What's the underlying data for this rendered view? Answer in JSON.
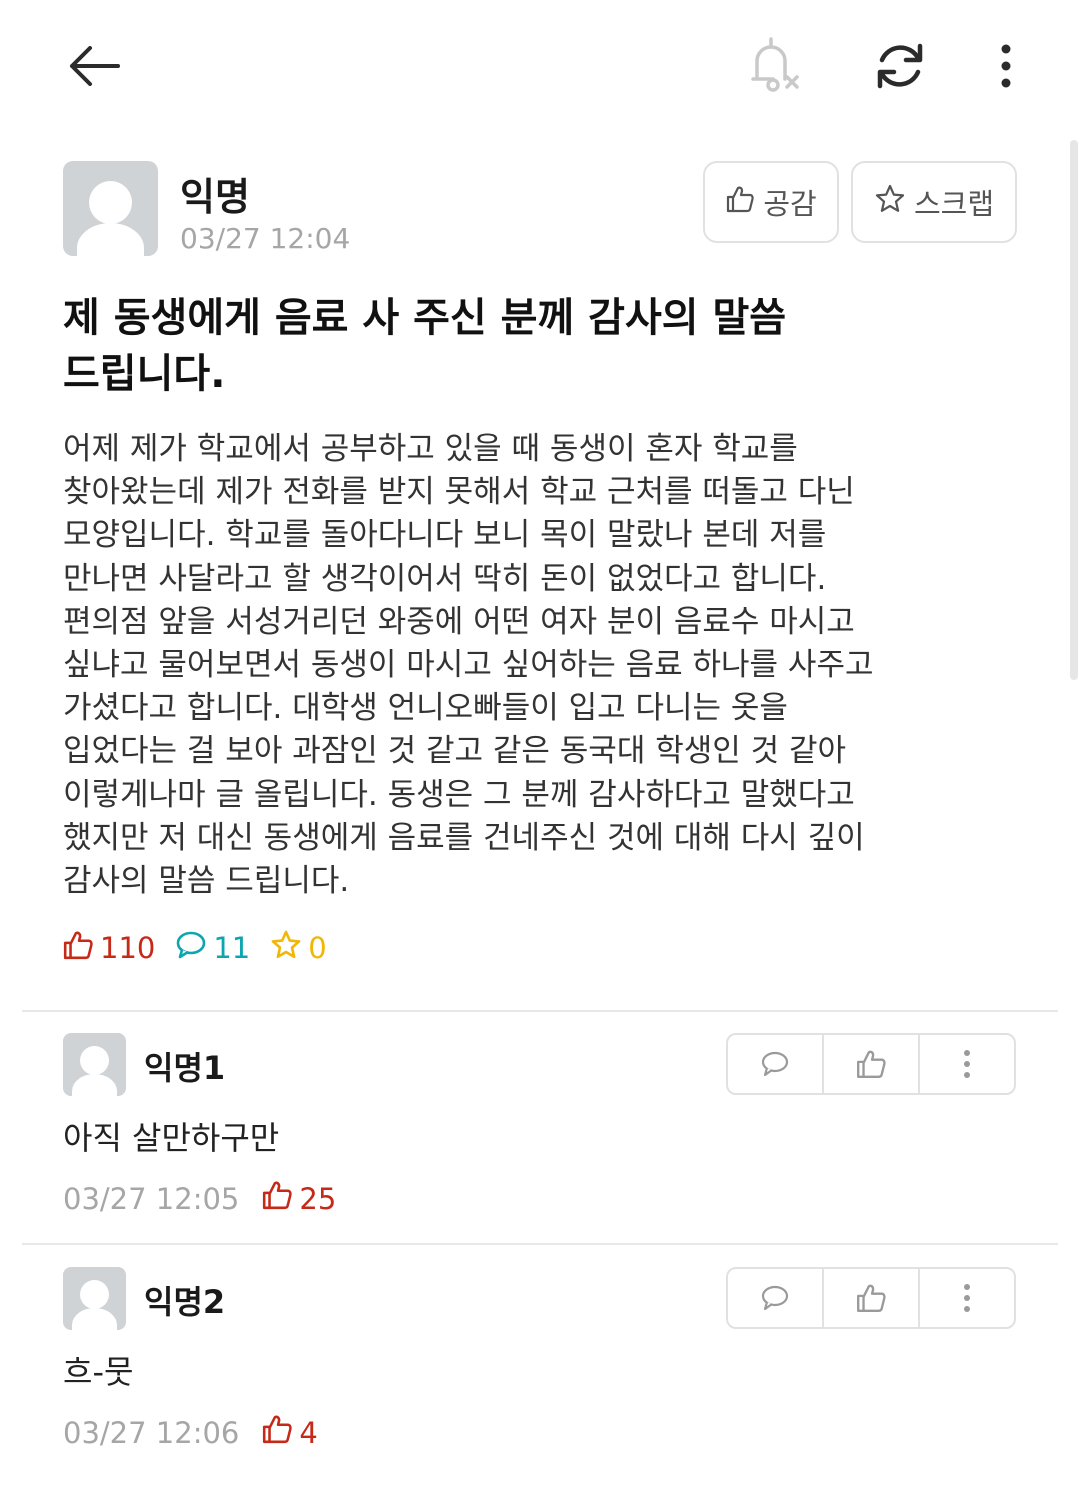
{
  "post": {
    "author": "익명",
    "time": "03/27 12:04",
    "like_button_label": "공감",
    "scrap_button_label": "스크랩",
    "title": "제 동생에게 음료 사 주신 분께 감사의 말씀\n드립니다.",
    "content": "어제 제가 학교에서 공부하고 있을 때 동생이 혼자 학교를\n찾아왔는데 제가 전화를 받지 못해서 학교 근처를 떠돌고 다닌\n모양입니다. 학교를 돌아다니다 보니 목이 말랐나 본데 저를\n만나면 사달라고 할 생각이어서 딱히 돈이 없었다고 합니다.\n편의점 앞을 서성거리던 와중에 어떤 여자 분이 음료수 마시고\n싶냐고 물어보면서 동생이 마시고 싶어하는 음료 하나를 사주고\n가셨다고 합니다. 대학생 언니오빠들이 입고 다니는 옷을\n입었다는 걸 보아 과잠인 것 같고 같은 동국대 학생인 것 같아\n이렇게나마 글 올립니다. 동생은 그 분께 감사하다고 말했다고\n했지만 저 대신 동생에게 음료를 건네주신 것에 대해 다시 깊이\n감사의 말씀 드립니다.",
    "stats": {
      "likes": "110",
      "comments": "11",
      "scraps": "0"
    }
  },
  "comments": [
    {
      "author": "익명1",
      "text": "아직 살만하구만",
      "time": "03/27 12:05",
      "likes": "25"
    },
    {
      "author": "익명2",
      "text": "흐-뭇",
      "time": "03/27 12:06",
      "likes": "4"
    }
  ],
  "colors": {
    "like": "#c62917",
    "comment": "#0ca5b0",
    "scrap": "#f2b705",
    "muted": "#a6a6a6"
  },
  "icons": {
    "top_bar": [
      "back-arrow-icon",
      "notification-off-icon",
      "refresh-icon",
      "more-vertical-icon"
    ],
    "comment_actions": [
      "reply-icon",
      "thumbs-up-icon",
      "more-vertical-icon"
    ]
  }
}
